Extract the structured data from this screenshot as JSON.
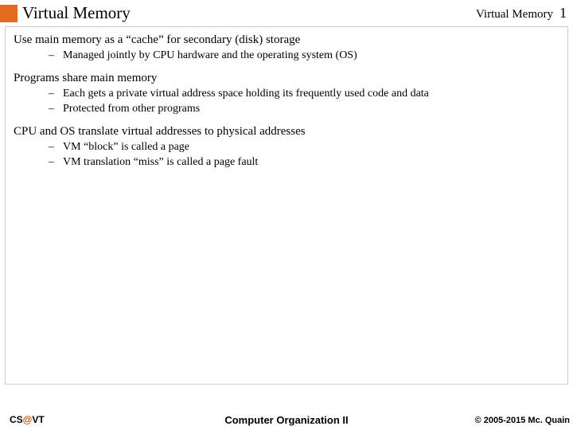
{
  "header": {
    "title": "Virtual Memory",
    "right_label": "Virtual Memory",
    "page_number": "1"
  },
  "sections": [
    {
      "heading": "Use main memory as a “cache” for secondary (disk) storage",
      "items": [
        "Managed jointly by CPU hardware and the operating system (OS)"
      ]
    },
    {
      "heading": "Programs share main memory",
      "items": [
        "Each gets a private virtual address space holding its frequently used code and data",
        "Protected from other programs"
      ]
    },
    {
      "heading": "CPU and OS translate virtual addresses to physical addresses",
      "items": [
        "VM “block” is called a page",
        "VM translation “miss” is called a page fault"
      ]
    }
  ],
  "footer": {
    "left_prefix": "CS",
    "left_at": "@",
    "left_suffix": "VT",
    "center": "Computer Organization II",
    "right": "© 2005-2015 Mc. Quain"
  }
}
